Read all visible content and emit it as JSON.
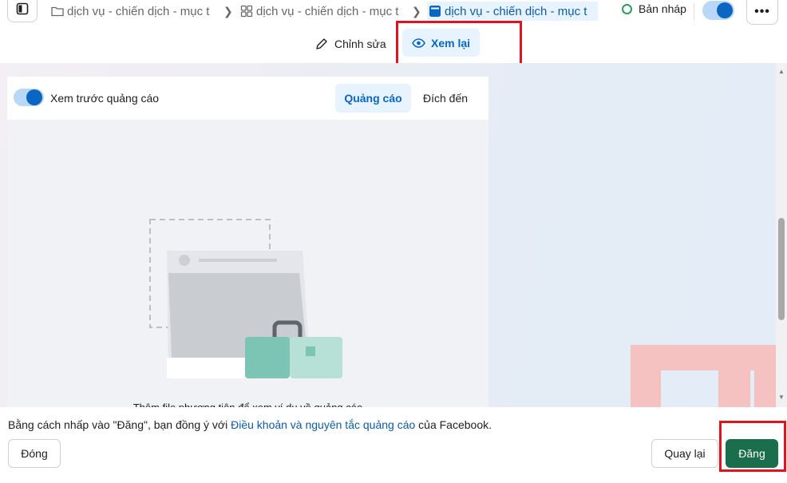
{
  "topbar": {
    "breadcrumbs": [
      {
        "label": "dịch vụ - chiến dịch - mục t",
        "icon": "folder-icon"
      },
      {
        "label": "dịch vụ - chiến dịch - mục t",
        "icon": "grid-icon"
      },
      {
        "label": "dịch vụ - chiến dịch - mục t",
        "icon": "ad-icon"
      }
    ],
    "status": "Bản nháp",
    "more_label": "•••"
  },
  "mode_tabs": {
    "edit": "Chỉnh sửa",
    "review": "Xem lại"
  },
  "preview": {
    "toggle_label": "Xem trước quảng cáo",
    "tabs": [
      "Quảng cáo",
      "Đích đến"
    ],
    "hint": "Thêm file phương tiện để xem ví dụ về quảng cáo"
  },
  "footer": {
    "terms_prefix": "Bằng cách nhấp vào \"Đăng\", bạn đồng ý với ",
    "terms_link": "Điều khoản và nguyên tắc quảng cáo",
    "terms_suffix": " của Facebook.",
    "close": "Đóng",
    "back": "Quay lại",
    "publish": "Đăng"
  },
  "colors": {
    "accent": "#0a66c2",
    "publish": "#1b6e4b",
    "highlight": "#e0141e",
    "status_dot": "#2e9b5c"
  }
}
